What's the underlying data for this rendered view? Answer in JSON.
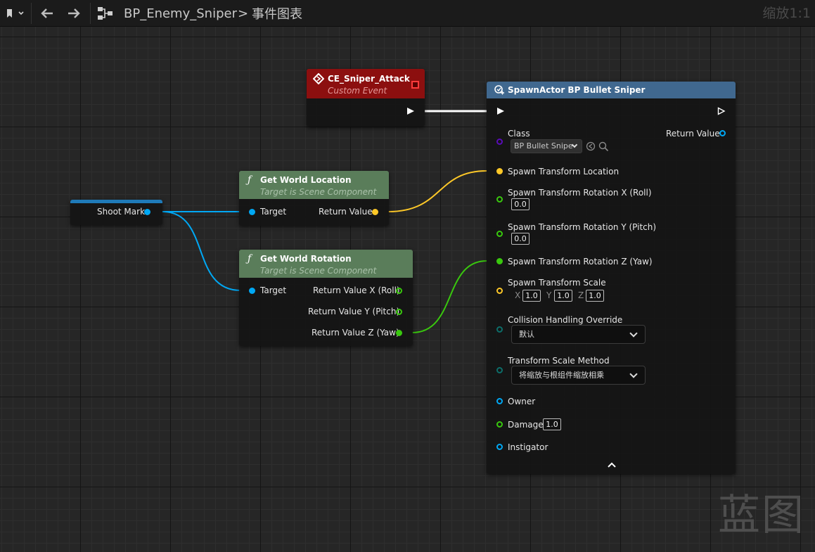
{
  "topbar": {
    "breadcrumb_blueprint": "BP_Enemy_Sniper",
    "breadcrumb_separator": ">",
    "breadcrumb_graph": "事件图表",
    "zoom": "缩放1:1"
  },
  "reroute_node": {
    "pin_label": "Shoot Mark"
  },
  "custom_event_node": {
    "title": "CE_Sniper_Attack",
    "subtitle": "Custom Event",
    "header_color": "#8c0f0f"
  },
  "get_world_location_node": {
    "title": "Get World Location",
    "subtitle": "Target is Scene Component",
    "header_color": "#5a7d5a",
    "target_label": "Target",
    "return_label": "Return Value"
  },
  "get_world_rotation_node": {
    "title": "Get World Rotation",
    "subtitle": "Target is Scene Component",
    "target_label": "Target",
    "return_x": "Return Value X (Roll)",
    "return_y": "Return Value Y (Pitch)",
    "return_z": "Return Value Z (Yaw)"
  },
  "spawn_actor_node": {
    "title": "SpawnActor BP Bullet Sniper",
    "header_color": "#40688f",
    "class_label": "Class",
    "class_value": "BP Bullet Snipe",
    "return_label": "Return Value",
    "location_label": "Spawn Transform Location",
    "rot_x_label": "Spawn Transform Rotation X (Roll)",
    "rot_x_value": "0.0",
    "rot_y_label": "Spawn Transform Rotation Y (Pitch)",
    "rot_y_value": "0.0",
    "rot_z_label": "Spawn Transform Rotation Z (Yaw)",
    "scale_label": "Spawn Transform Scale",
    "scale_x_axis": "X",
    "scale_x": "1.0",
    "scale_y_axis": "Y",
    "scale_y": "1.0",
    "scale_z_axis": "Z",
    "scale_z": "1.0",
    "collision_label": "Collision Handling Override",
    "collision_value": "默认",
    "scale_method_label": "Transform Scale Method",
    "scale_method_value": "将缩放与根组件缩放相乘",
    "owner_label": "Owner",
    "damage_label": "Damage",
    "damage_value": "1.0",
    "instigator_label": "Instigator"
  },
  "pin_colors": {
    "object": "#00a8f4",
    "vector": "#fdc828",
    "float": "#39c80e",
    "class": "#5a0cb8",
    "byte": "#0c6e6a"
  },
  "watermark": "蓝图"
}
